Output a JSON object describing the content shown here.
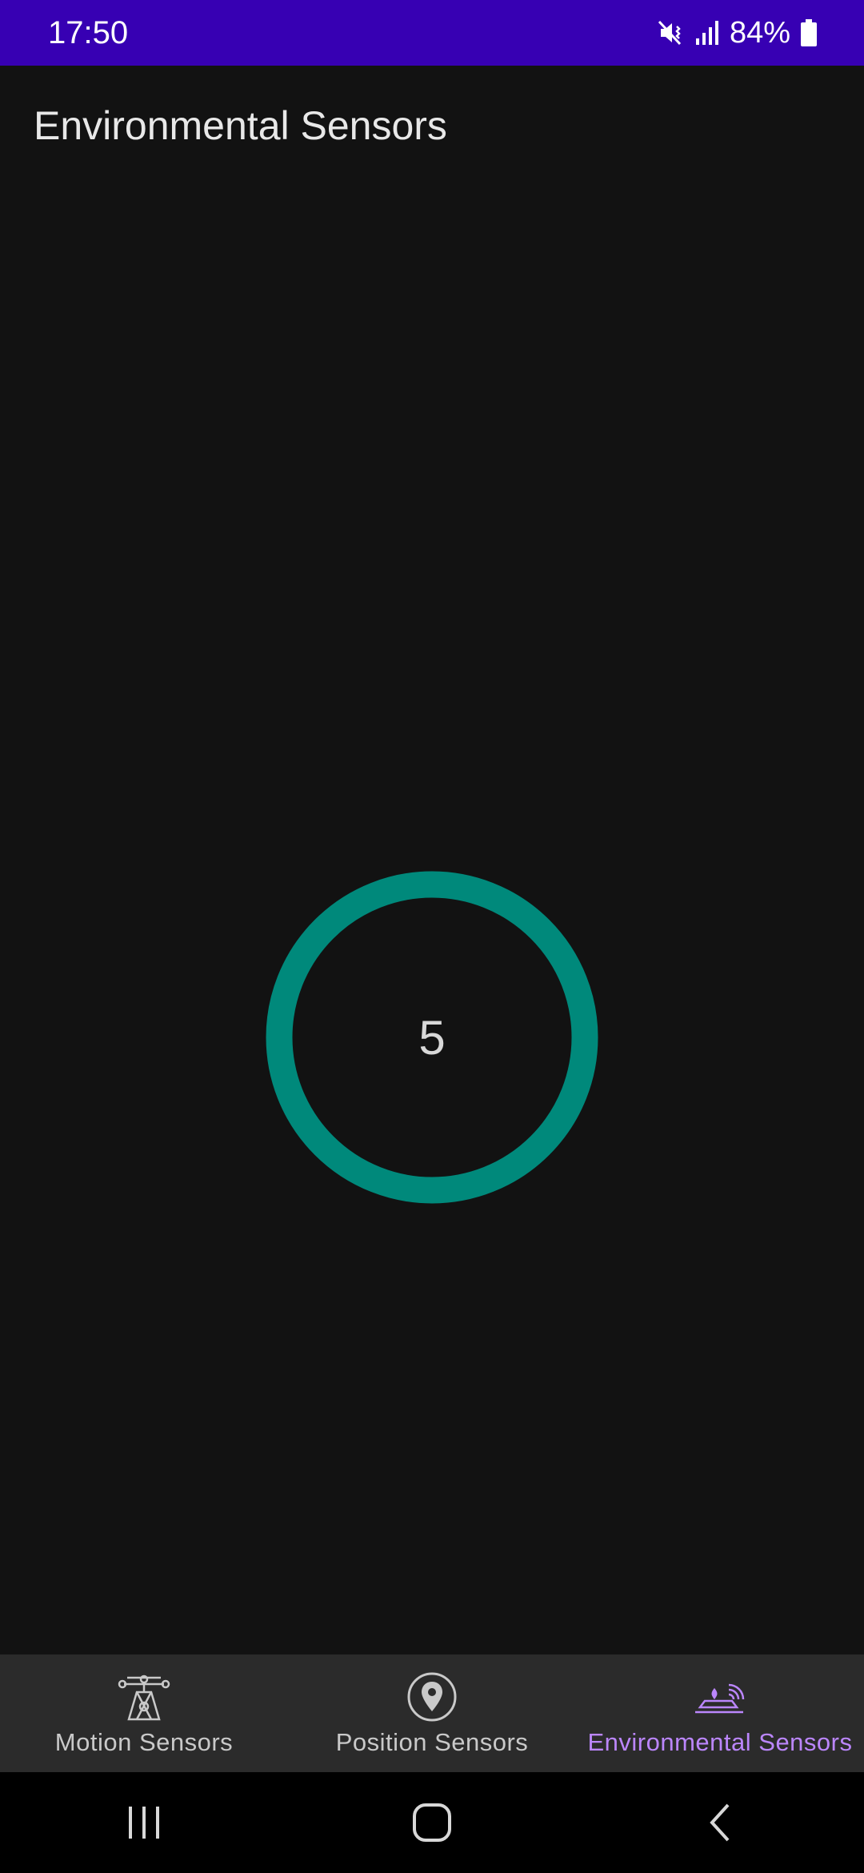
{
  "status_bar": {
    "time": "17:50",
    "battery": "84%",
    "icons": [
      "mute-vibrate-icon",
      "signal-icon",
      "battery-icon"
    ],
    "color": "#3700b3"
  },
  "app": {
    "title": "Environmental Sensors"
  },
  "sensor_ring": {
    "value": "5",
    "ring_color": "#00897b"
  },
  "bottom_nav": {
    "items": [
      {
        "label": "Motion Sensors",
        "icon": "motion-sensor-icon",
        "active": false
      },
      {
        "label": "Position Sensors",
        "icon": "location-pin-icon",
        "active": false
      },
      {
        "label": "Environmental Sensors",
        "icon": "environment-sensor-icon",
        "active": true
      }
    ],
    "active_color": "#bb86fc",
    "inactive_color": "#c9c9c9"
  },
  "system_nav": {
    "buttons": [
      "recents-button",
      "home-button",
      "back-button"
    ]
  }
}
